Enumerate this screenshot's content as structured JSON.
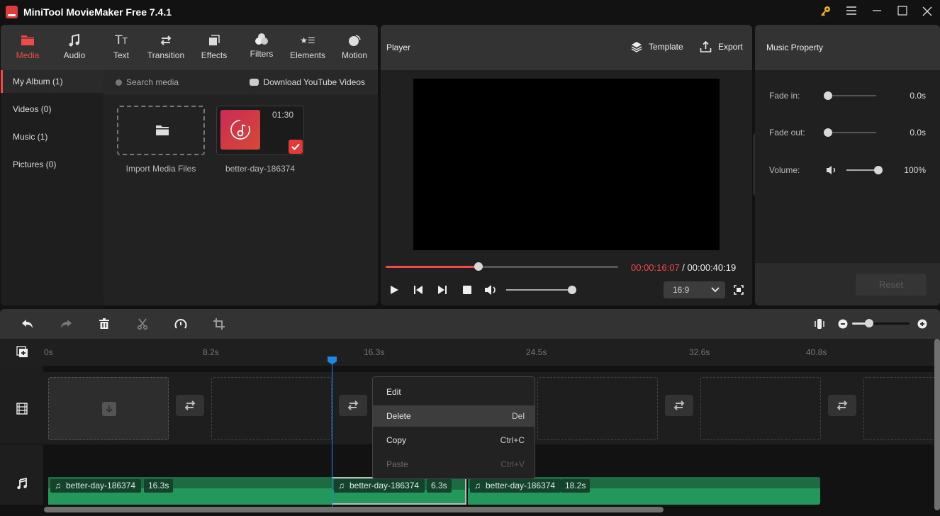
{
  "app": {
    "title": "MiniTool MovieMaker Free 7.4.1",
    "window_controls": [
      "key-icon",
      "menu-icon",
      "minimize-icon",
      "maximize-icon",
      "close-icon"
    ],
    "accent_color": "#f04a48"
  },
  "nav": {
    "tabs": [
      {
        "label": "Media",
        "icon": "folder-icon",
        "active": true
      },
      {
        "label": "Audio",
        "icon": "music-icon"
      },
      {
        "label": "Text",
        "icon": "text-icon"
      },
      {
        "label": "Transition",
        "icon": "transition-icon"
      },
      {
        "label": "Effects",
        "icon": "effects-icon"
      },
      {
        "label": "Filters",
        "icon": "filters-icon"
      },
      {
        "label": "Elements",
        "icon": "elements-icon"
      },
      {
        "label": "Motion",
        "icon": "motion-icon"
      }
    ]
  },
  "albums": [
    {
      "label": "My Album (1)",
      "active": true
    },
    {
      "label": "Videos (0)"
    },
    {
      "label": "Music (1)"
    },
    {
      "label": "Pictures (0)"
    }
  ],
  "media": {
    "search_placeholder": "Search media",
    "download_label": "Download YouTube Videos",
    "import_label": "Import Media Files",
    "items": [
      {
        "name": "better-day-186374",
        "duration": "01:30",
        "selected": true
      }
    ]
  },
  "player": {
    "title": "Player",
    "template_label": "Template",
    "export_label": "Export",
    "current_time": "00:00:16:07",
    "separator": " / ",
    "total_time": "00:00:40:19",
    "progress_percent": 40,
    "volume_percent": 100,
    "aspect_ratio": "16:9"
  },
  "properties": {
    "title": "Music Property",
    "fade_in_label": "Fade in:",
    "fade_in_value": "0.0s",
    "fade_out_label": "Fade out:",
    "fade_out_value": "0.0s",
    "volume_label": "Volume:",
    "volume_value": "100%",
    "reset_label": "Reset"
  },
  "timeline": {
    "ruler_ticks": [
      "0s",
      "8.2s",
      "16.3s",
      "24.5s",
      "32.6s",
      "40.8s"
    ],
    "zoom_percent": 30,
    "audio_clips": [
      {
        "name": "better-day-186374",
        "duration": "16.3s"
      },
      {
        "name": "better-day-186374",
        "duration": "6.3s",
        "selected": true
      },
      {
        "name": "better-day-186374",
        "duration": "18.2s"
      }
    ]
  },
  "context_menu": {
    "items": [
      {
        "label": "Edit",
        "shortcut": ""
      },
      {
        "label": "Delete",
        "shortcut": "Del",
        "highlighted": true
      },
      {
        "label": "Copy",
        "shortcut": "Ctrl+C"
      },
      {
        "label": "Paste",
        "shortcut": "Ctrl+V",
        "disabled": true
      }
    ]
  }
}
